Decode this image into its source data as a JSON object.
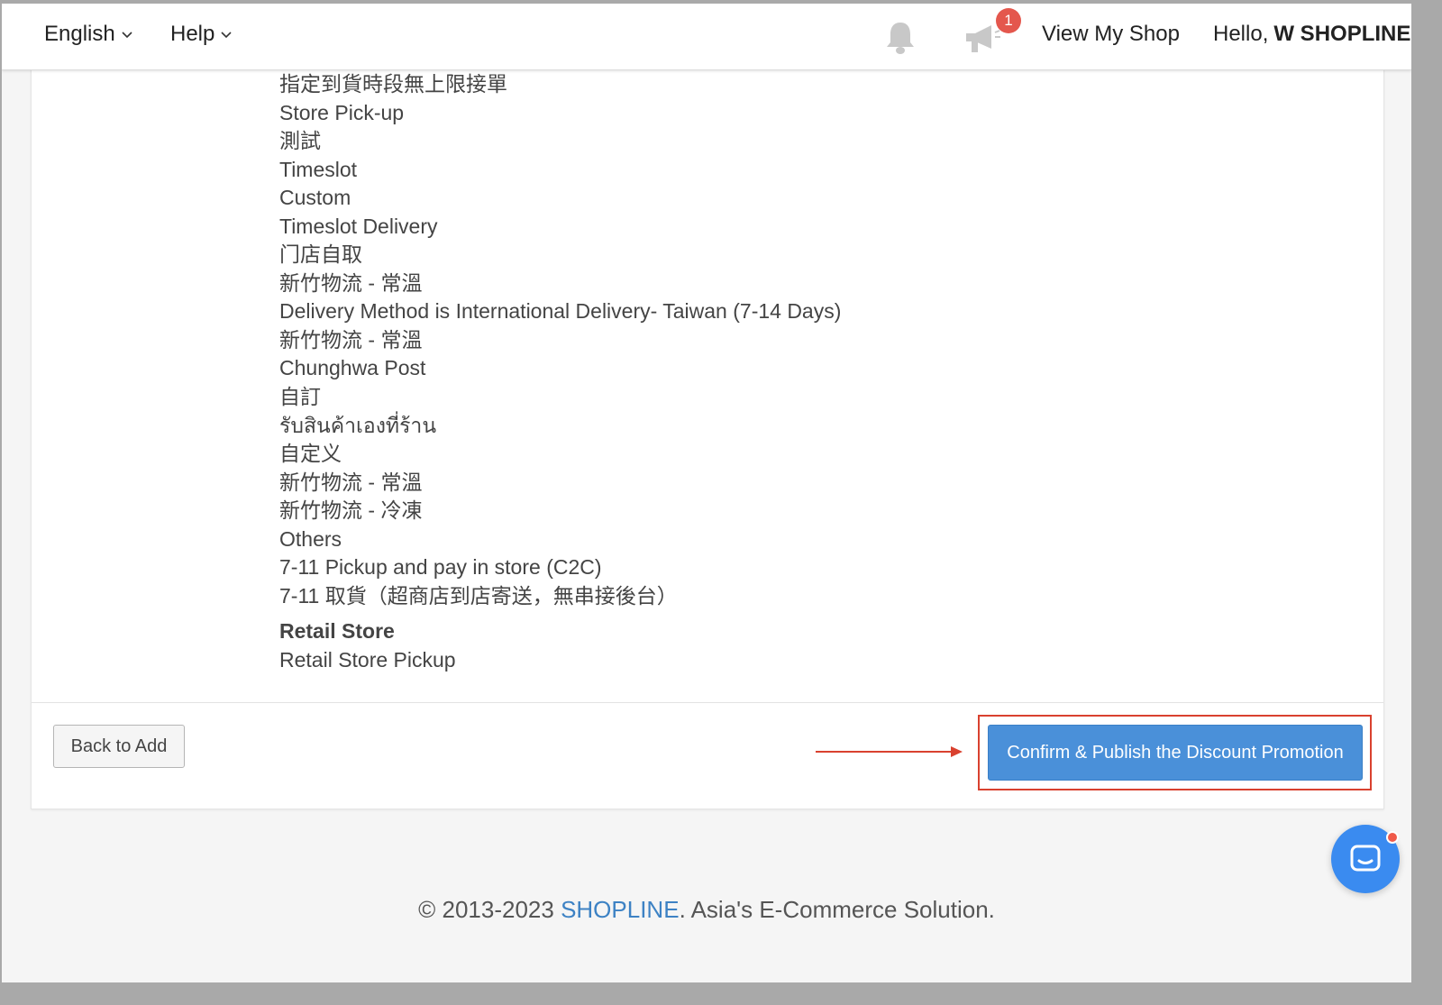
{
  "header": {
    "language_label": "English",
    "help_label": "Help",
    "notification_count": "1",
    "view_shop_label": "View My Shop",
    "greeting_prefix": "Hello,",
    "user_name": "W SHOPLINE"
  },
  "delivery_methods": [
    "指定到貨時段無上限接單",
    "Store Pick-up",
    "測試",
    "Timeslot",
    "Custom",
    "Timeslot Delivery",
    "门店自取",
    "新竹物流 - 常溫",
    "Delivery Method is International Delivery- Taiwan (7-14 Days)",
    "新竹物流 - 常溫",
    "Chunghwa Post",
    "自訂",
    "รับสินค้าเองที่ร้าน",
    "自定义",
    "新竹物流 - 常溫",
    "新竹物流 - 冷凍",
    "Others",
    "7-11 Pickup and pay in store (C2C)",
    "7-11 取貨（超商店到店寄送，無串接後台）"
  ],
  "retail": {
    "title": "Retail Store",
    "item": "Retail Store Pickup"
  },
  "actions": {
    "back_label": "Back to Add",
    "confirm_label": "Confirm & Publish the Discount Promotion"
  },
  "footer": {
    "prefix": "© 2013-2023 ",
    "brand": "SHOPLINE",
    "suffix": ". Asia's E-Commerce Solution."
  },
  "colors": {
    "primary": "#4a90d9",
    "highlight": "#d9412f",
    "brand_link": "#3d82c4",
    "badge": "#e4574d",
    "chat": "#3a8bf0"
  },
  "icons": {
    "notifications": "bell-icon",
    "announcements": "megaphone-icon",
    "chat": "chat-icon",
    "dropdown": "chevron-down-icon"
  }
}
